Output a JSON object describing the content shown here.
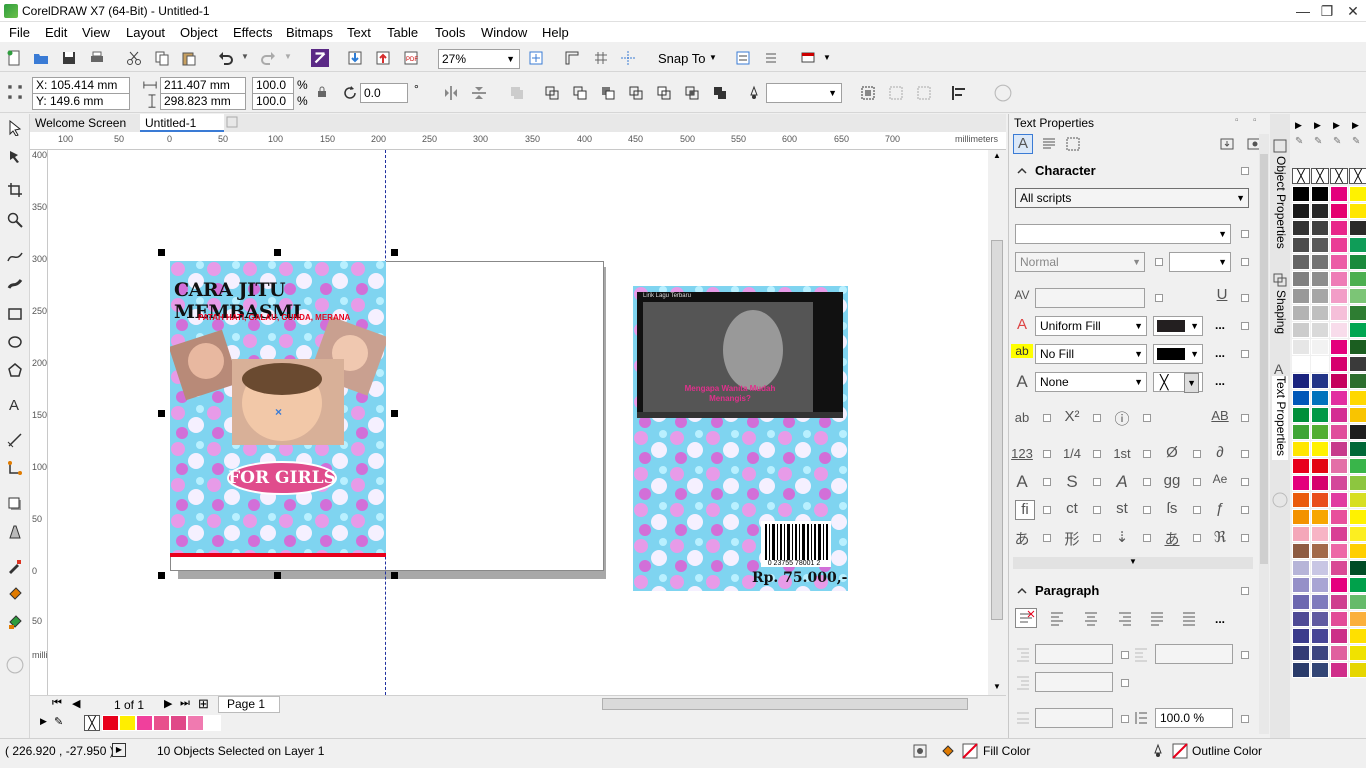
{
  "window": {
    "title": "CorelDRAW X7 (64-Bit) - Untitled-1",
    "min": "—",
    "restore": "❐",
    "close": "✕"
  },
  "menu": [
    "File",
    "Edit",
    "View",
    "Layout",
    "Object",
    "Effects",
    "Bitmaps",
    "Text",
    "Table",
    "Tools",
    "Window",
    "Help"
  ],
  "toolbar": {
    "zoom": "27%",
    "snap_to": "Snap To"
  },
  "propbar": {
    "x": "X: 105.414 mm",
    "y": "Y: 149.6 mm",
    "w": "211.407 mm",
    "h": "298.823 mm",
    "sx": "100.0",
    "sy": "100.0",
    "pct1": "%",
    "pct2": "%",
    "rotation": "0.0",
    "deg": "°"
  },
  "tabs": {
    "welcome": "Welcome Screen",
    "doc": "Untitled-1"
  },
  "ruler": {
    "unit": "millimeters",
    "h_ticks": [
      "100",
      "50",
      "0",
      "50",
      "100",
      "150",
      "200",
      "250",
      "300",
      "350",
      "400",
      "450",
      "500",
      "550",
      "600",
      "650",
      "700",
      "750"
    ],
    "v_ticks": [
      "400",
      "350",
      "300",
      "250",
      "200",
      "150",
      "100",
      "50",
      "0",
      "50"
    ],
    "v_unit": "millimeters"
  },
  "cover_front": {
    "title": "CARA JITU MEMBASMI",
    "subtitle": "PATAH HATI, GALAU, GUNDA, MERANA",
    "badge": "FOR GIRLS"
  },
  "cover_back": {
    "video_title": "Lirik Lagu Terbaru",
    "caption_line1": "Mengapa Wanita Mudah",
    "caption_line2": "Menangis?",
    "barcode_number": "0 23755 78001 2",
    "price": "Rp. 75.000,-"
  },
  "pagebar": {
    "pages": "1 of 1",
    "page_tab": "Page 1"
  },
  "status": {
    "coords": "( 226.920 , -27.950 )",
    "selection": "10 Objects Selected on Layer 1",
    "fill": "Fill Color",
    "outline": "Outline Color"
  },
  "panel": {
    "title": "Text Properties",
    "character": "Character",
    "scripts": "All scripts",
    "font_style": "Normal",
    "fill_type": "Uniform Fill",
    "bg_fill": "No Fill",
    "outline": "None",
    "paragraph": "Paragraph",
    "line_spacing": "100.0 %",
    "fractions": "1/4",
    "ordinal": "1st",
    "num": "123"
  },
  "side_tabs": [
    "Object Properties",
    "Shaping",
    "Text Properties"
  ],
  "colors": {
    "doc_palette": [
      "#e8001c",
      "#ffee00",
      "#f0409c",
      "#e8508c",
      "#e04888",
      "#f07ab0",
      "#ffffff"
    ],
    "palette_col1": [
      "#000000",
      "#1a1a1a",
      "#333333",
      "#4d4d4d",
      "#666666",
      "#808080",
      "#999999",
      "#b3b3b3",
      "#cccccc",
      "#e6e6e6",
      "#ffffff",
      "#1a237e",
      "#0057b8",
      "#008f3a",
      "#3fa535",
      "#ffe600",
      "#e8001c",
      "#e4007c",
      "#ea5b0c",
      "#f39200",
      "#f4a7b9",
      "#8e5c42",
      "#b6b4d8",
      "#9590c8",
      "#6d68b0",
      "#4f4a95",
      "#3b3b8c",
      "#343b75",
      "#2b3c6b",
      "#1e4f90"
    ],
    "palette_col2": [
      "#000000",
      "#262626",
      "#404040",
      "#595959",
      "#737373",
      "#8c8c8c",
      "#a6a6a6",
      "#bfbfbf",
      "#d9d9d9",
      "#f2f2f2",
      "#ffffff",
      "#233588",
      "#0072bc",
      "#009846",
      "#52ae32",
      "#fff100",
      "#e30613",
      "#d6006d",
      "#e94e1b",
      "#f7a600",
      "#f7b4c5",
      "#a26a4a",
      "#c8c6e4",
      "#a9a5d4",
      "#7f7bbd",
      "#5f59a0",
      "#474596",
      "#3d4580",
      "#324575",
      "#245aa0"
    ],
    "palette_col3": [
      "#e4007c",
      "#e5006f",
      "#e8268a",
      "#ea3d96",
      "#ec5ca6",
      "#ee7cb6",
      "#f29dc7",
      "#f5bfd9",
      "#f8dceb",
      "#e4007c",
      "#d6006d",
      "#c5005c",
      "#e22da0",
      "#d42e93",
      "#e04e9c",
      "#c73b8c",
      "#e36fa7",
      "#d4479a",
      "#e13ba0",
      "#e84f9c",
      "#d93f95",
      "#ed68a7",
      "#d94a95",
      "#e5007e",
      "#cf3f8f",
      "#e24b97",
      "#cc2f88",
      "#e0609f",
      "#d02e8a",
      "#e8378f"
    ],
    "palette_col4": [
      "#fff200",
      "#ffe600",
      "#2b2a29",
      "#0f9d58",
      "#1a8a3c",
      "#4caf50",
      "#7cc576",
      "#2e7d32",
      "#00a651",
      "#1b5e20",
      "#3a3a3a",
      "#2d6e2e",
      "#ffd800",
      "#f9c400",
      "#1e1e1e",
      "#006837",
      "#39b54a",
      "#8dc63f",
      "#d7df23",
      "#fff200",
      "#fcee21",
      "#ffcf00",
      "#004d26",
      "#00a14b",
      "#66bb6a",
      "#fbb03b",
      "#ffe000",
      "#f0e200",
      "#e6d600",
      "#ffd200"
    ],
    "brand_green": "#2e9d3e",
    "selection_red": "#e8001c"
  }
}
